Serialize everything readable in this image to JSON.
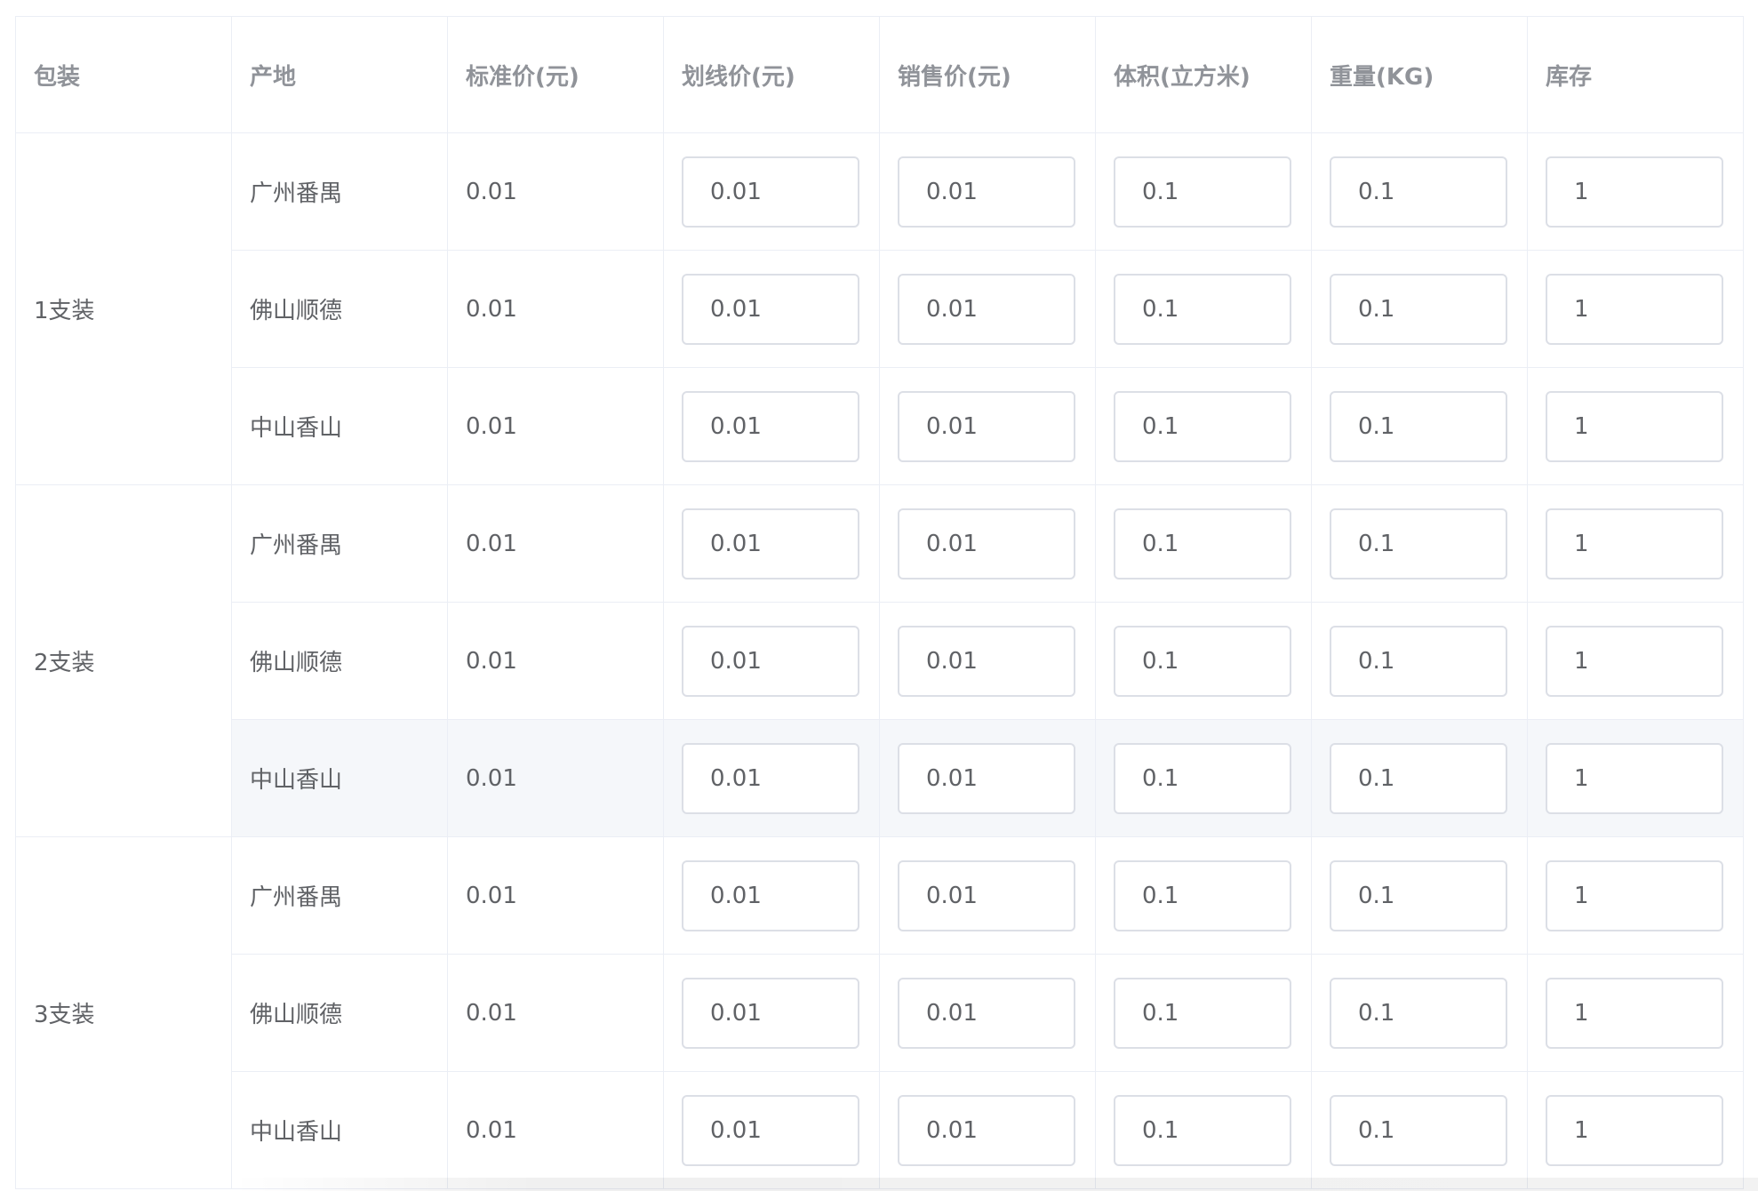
{
  "table": {
    "headers": [
      "包装",
      "产地",
      "标准价(元)",
      "划线价(元)",
      "销售价(元)",
      "体积(立方米)",
      "重量(KG)",
      "库存"
    ],
    "groups": [
      {
        "pack": "1支装",
        "rows": [
          {
            "origin": "广州番禺",
            "standard_price": "0.01",
            "strike_price": "0.01",
            "sale_price": "0.01",
            "volume": "0.1",
            "weight": "0.1",
            "stock": "1"
          },
          {
            "origin": "佛山顺德",
            "standard_price": "0.01",
            "strike_price": "0.01",
            "sale_price": "0.01",
            "volume": "0.1",
            "weight": "0.1",
            "stock": "1"
          },
          {
            "origin": "中山香山",
            "standard_price": "0.01",
            "strike_price": "0.01",
            "sale_price": "0.01",
            "volume": "0.1",
            "weight": "0.1",
            "stock": "1"
          }
        ]
      },
      {
        "pack": "2支装",
        "rows": [
          {
            "origin": "广州番禺",
            "standard_price": "0.01",
            "strike_price": "0.01",
            "sale_price": "0.01",
            "volume": "0.1",
            "weight": "0.1",
            "stock": "1"
          },
          {
            "origin": "佛山顺德",
            "standard_price": "0.01",
            "strike_price": "0.01",
            "sale_price": "0.01",
            "volume": "0.1",
            "weight": "0.1",
            "stock": "1"
          },
          {
            "origin": "中山香山",
            "standard_price": "0.01",
            "strike_price": "0.01",
            "sale_price": "0.01",
            "volume": "0.1",
            "weight": "0.1",
            "stock": "1"
          }
        ]
      },
      {
        "pack": "3支装",
        "rows": [
          {
            "origin": "广州番禺",
            "standard_price": "0.01",
            "strike_price": "0.01",
            "sale_price": "0.01",
            "volume": "0.1",
            "weight": "0.1",
            "stock": "1"
          },
          {
            "origin": "佛山顺德",
            "standard_price": "0.01",
            "strike_price": "0.01",
            "sale_price": "0.01",
            "volume": "0.1",
            "weight": "0.1",
            "stock": "1"
          },
          {
            "origin": "中山香山",
            "standard_price": "0.01",
            "strike_price": "0.01",
            "sale_price": "0.01",
            "volume": "0.1",
            "weight": "0.1",
            "stock": "1"
          }
        ]
      }
    ]
  }
}
